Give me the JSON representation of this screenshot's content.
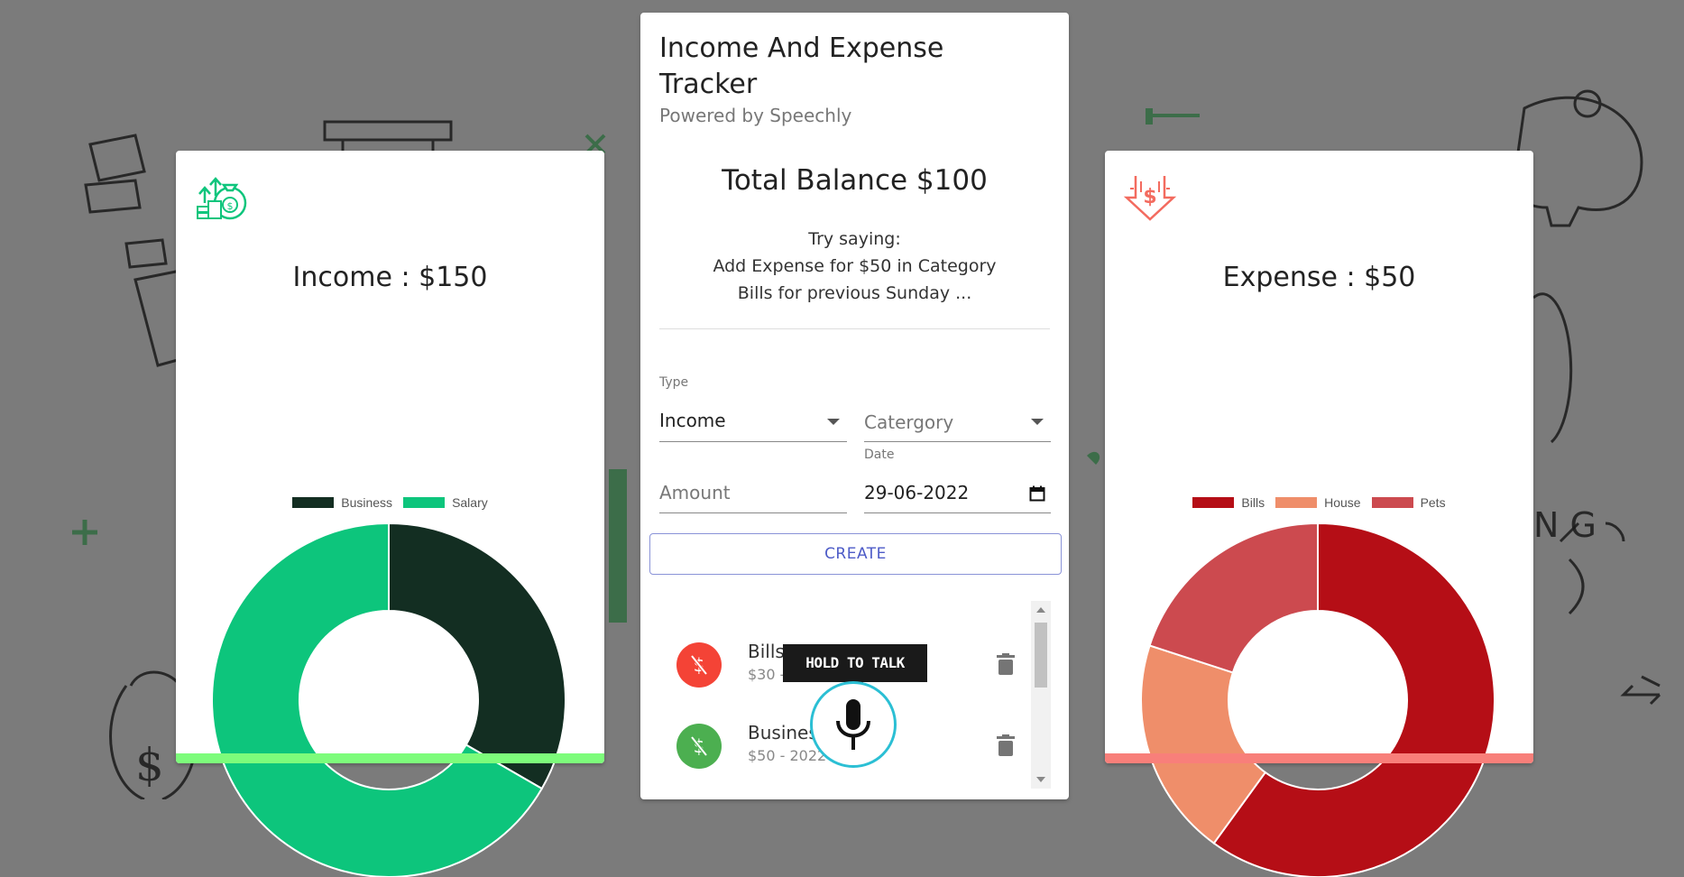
{
  "income_card": {
    "title": "Income : $150",
    "icon": "money-bag-growth-icon",
    "bar_color": "#7dfc7b",
    "chart_data": {
      "type": "pie",
      "categories": [
        "Business",
        "Salary"
      ],
      "values": [
        50,
        100
      ],
      "colors": [
        "#132e22",
        "#0dc57c"
      ],
      "title": "Income : $150",
      "legend": "top"
    }
  },
  "expense_card": {
    "title": "Expense : $50",
    "icon": "dollar-down-arrow-icon",
    "bar_color": "#f87f7a",
    "chart_data": {
      "type": "pie",
      "categories": [
        "Bills",
        "House",
        "Pets"
      ],
      "values": [
        30,
        10,
        10
      ],
      "colors": [
        "#b50e16",
        "#ef8e6a",
        "#cc4a4f"
      ],
      "title": "Expense : $50",
      "legend": "top"
    }
  },
  "main": {
    "title": "Income And Expense Tracker",
    "subtitle": "Powered by Speechly",
    "balance": "Total Balance $100",
    "hint_line1": "Try saying:",
    "hint_line2": "Add Expense for $50 in Category",
    "hint_line3": "Bills for previous Sunday ...",
    "form": {
      "type_label": "Type",
      "type_value": "Income",
      "category_placeholder": "Catergory",
      "amount_placeholder": "Amount",
      "date_label": "Date",
      "date_value": "29-06-2022"
    },
    "create_label": "CREATE",
    "transactions": [
      {
        "name": "Bills",
        "detail": "$30 - ",
        "color": "#f44336",
        "icon": "money-off-icon"
      },
      {
        "name": "Busines",
        "detail": "$50 - 2022",
        "color": "#4caf50",
        "icon": "money-off-icon"
      }
    ]
  },
  "voice": {
    "tooltip": "HOLD TO TALK",
    "icon": "microphone-icon"
  }
}
